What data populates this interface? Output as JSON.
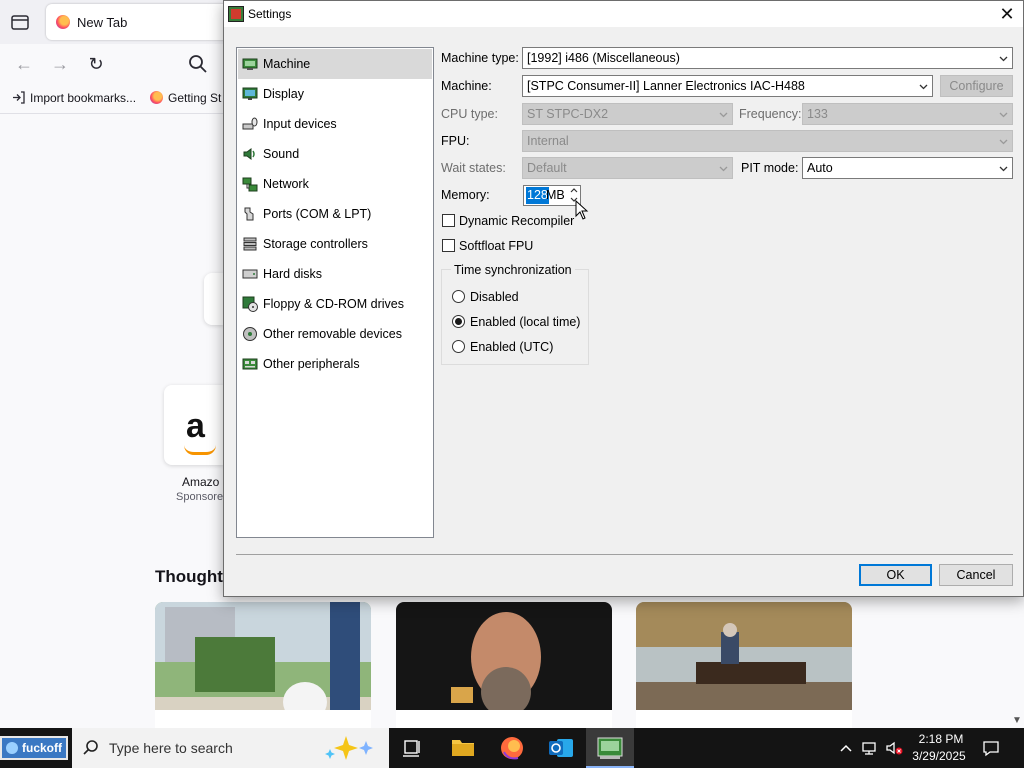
{
  "browser": {
    "tab_title": "New Tab",
    "bookmarks": [
      {
        "label": "Import bookmarks..."
      },
      {
        "label": "Getting St"
      }
    ],
    "tile": {
      "name": "Amazo",
      "sponsored": "Sponsore"
    },
    "stories_title": "Thought-"
  },
  "dialog": {
    "title": "Settings",
    "nav": [
      {
        "label": "Machine",
        "icon": "machine-icon"
      },
      {
        "label": "Display",
        "icon": "display-icon"
      },
      {
        "label": "Input devices",
        "icon": "input-devices-icon"
      },
      {
        "label": "Sound",
        "icon": "sound-icon"
      },
      {
        "label": "Network",
        "icon": "network-icon"
      },
      {
        "label": "Ports (COM & LPT)",
        "icon": "ports-icon"
      },
      {
        "label": "Storage controllers",
        "icon": "storage-icon"
      },
      {
        "label": "Hard disks",
        "icon": "hard-disk-icon"
      },
      {
        "label": "Floppy & CD-ROM drives",
        "icon": "floppy-cdrom-icon"
      },
      {
        "label": "Other removable devices",
        "icon": "removable-devices-icon"
      },
      {
        "label": "Other peripherals",
        "icon": "peripherals-icon"
      }
    ],
    "selected_nav": "Machine",
    "machine_type": {
      "label": "Machine type:",
      "value": "[1992] i486 (Miscellaneous)"
    },
    "machine": {
      "label": "Machine:",
      "value": "[STPC Consumer-II] Lanner Electronics IAC-H488",
      "configure": "Configure"
    },
    "cpu_type": {
      "label": "CPU type:",
      "value": "ST STPC-DX2"
    },
    "frequency": {
      "label": "Frequency:",
      "value": "133"
    },
    "fpu": {
      "label": "FPU:",
      "value": "Internal"
    },
    "wait_states": {
      "label": "Wait states:",
      "value": "Default"
    },
    "pit_mode": {
      "label": "PIT mode:",
      "value": "Auto"
    },
    "memory": {
      "label": "Memory:",
      "value": "128",
      "unit": "MB"
    },
    "dynamic_recompiler": {
      "label": "Dynamic Recompiler",
      "checked": false
    },
    "softfloat": {
      "label": "Softfloat FPU",
      "checked": false
    },
    "time_sync": {
      "title": "Time synchronization",
      "options": [
        "Disabled",
        "Enabled (local time)",
        "Enabled (UTC)"
      ],
      "selected": "Enabled (local time)"
    },
    "ok": "OK",
    "cancel": "Cancel"
  },
  "taskbar": {
    "start_label": "fuckoff",
    "search_placeholder": "Type here to search",
    "time": "2:18 PM",
    "date": "3/29/2025"
  },
  "colors": {
    "accent": "#0078d7",
    "taskbar": "#141414",
    "dialog_bg": "#f0f0f0"
  }
}
